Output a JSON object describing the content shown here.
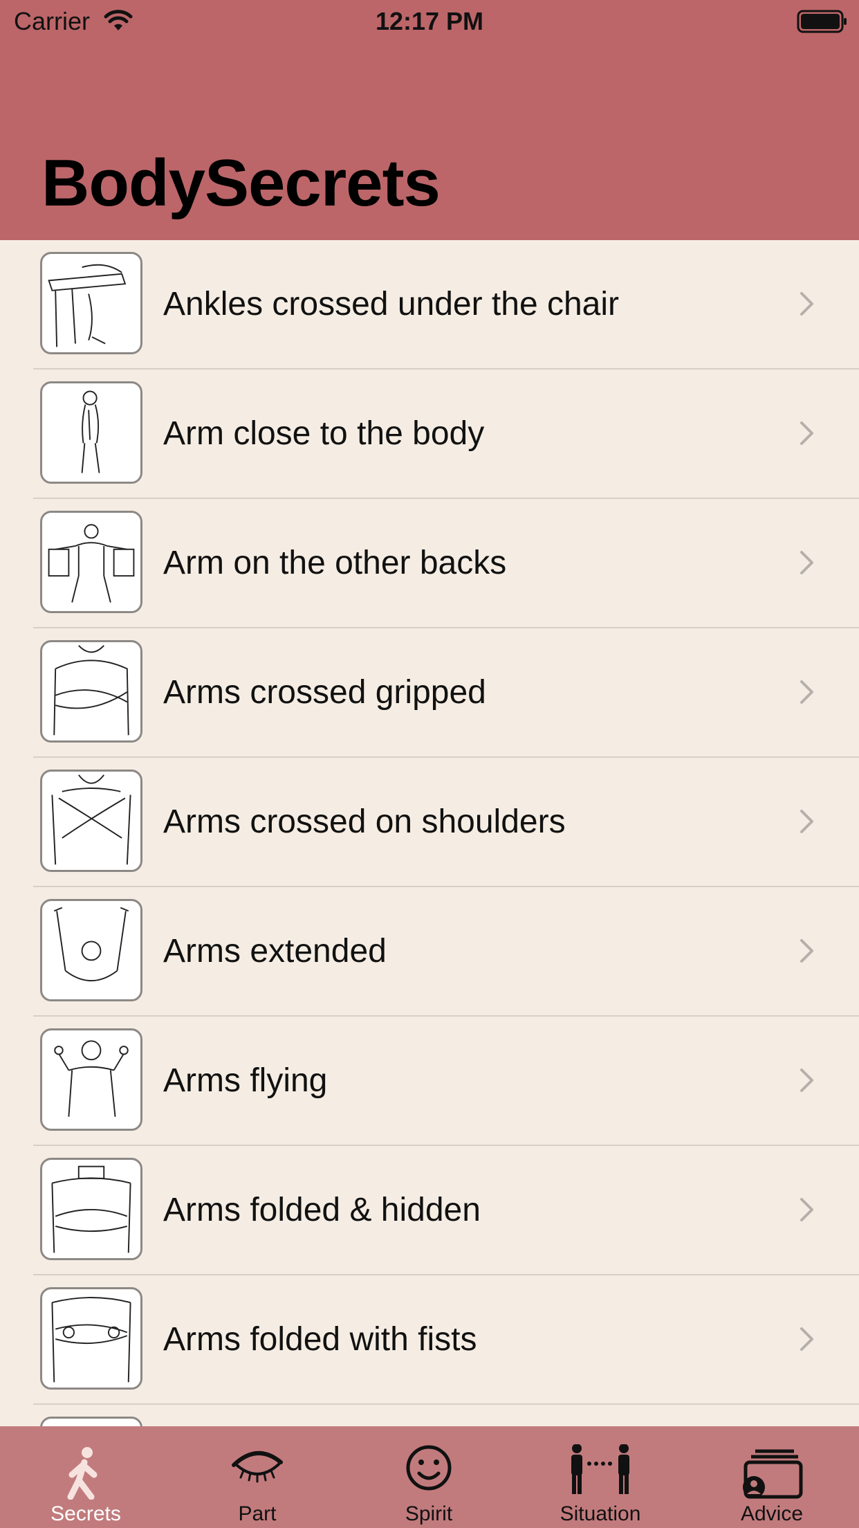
{
  "status": {
    "carrier": "Carrier",
    "time": "12:17 PM"
  },
  "nav": {
    "title": "BodySecrets"
  },
  "list": {
    "items": [
      {
        "label": "Ankles crossed under the chair",
        "icon": "ankles-crossed-sketch-icon"
      },
      {
        "label": "Arm close to the body",
        "icon": "arm-close-body-sketch-icon"
      },
      {
        "label": "Arm on the other backs",
        "icon": "arm-on-backs-sketch-icon"
      },
      {
        "label": "Arms crossed gripped",
        "icon": "arms-crossed-gripped-sketch-icon"
      },
      {
        "label": "Arms crossed on shoulders",
        "icon": "arms-crossed-shoulders-sketch-icon"
      },
      {
        "label": "Arms extended",
        "icon": "arms-extended-sketch-icon"
      },
      {
        "label": "Arms flying",
        "icon": "arms-flying-sketch-icon"
      },
      {
        "label": "Arms folded & hidden",
        "icon": "arms-folded-hidden-sketch-icon"
      },
      {
        "label": "Arms folded with fists",
        "icon": "arms-folded-fists-sketch-icon"
      },
      {
        "label": "",
        "icon": "partial-sketch-icon"
      }
    ]
  },
  "tabbar": {
    "tabs": [
      {
        "label": "Secrets",
        "icon": "walking-person-icon",
        "active": true
      },
      {
        "label": "Part",
        "icon": "eye-icon",
        "active": false
      },
      {
        "label": "Spirit",
        "icon": "smiley-icon",
        "active": false
      },
      {
        "label": "Situation",
        "icon": "two-people-icon",
        "active": false
      },
      {
        "label": "Advice",
        "icon": "contact-cards-icon",
        "active": false
      }
    ]
  },
  "colors": {
    "header": "#bc6669",
    "background": "#f5ede3",
    "tabbar": "#c27b7d",
    "separator": "#d8d0c8"
  }
}
